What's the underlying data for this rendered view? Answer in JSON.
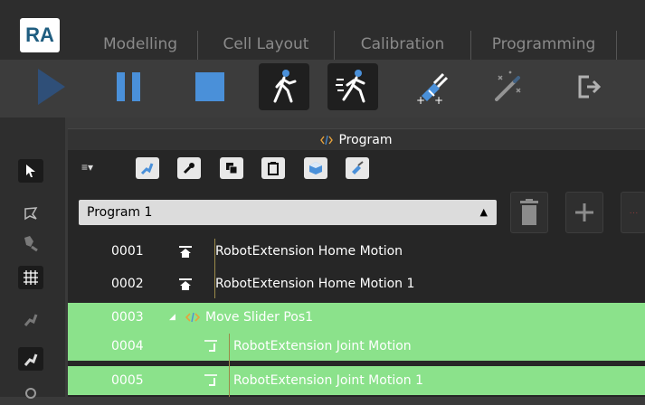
{
  "app": {
    "logo_text": "RA"
  },
  "tabs": [
    {
      "label": "Modelling"
    },
    {
      "label": "Cell Layout"
    },
    {
      "label": "Calibration"
    },
    {
      "label": "Programming"
    }
  ],
  "toolbar": {
    "buttons": [
      {
        "name": "play",
        "icon": "play-icon"
      },
      {
        "name": "pause",
        "icon": "pause-icon"
      },
      {
        "name": "stop",
        "icon": "stop-icon"
      },
      {
        "name": "walk",
        "icon": "walk-icon"
      },
      {
        "name": "run",
        "icon": "run-icon"
      },
      {
        "name": "teach",
        "icon": "teach-icon"
      },
      {
        "name": "magic",
        "icon": "magic-wand-icon"
      },
      {
        "name": "exit",
        "icon": "exit-icon"
      }
    ]
  },
  "panel": {
    "title": "Program",
    "program_select": {
      "value": "Program 1"
    }
  },
  "program_rows": [
    {
      "num": "0001",
      "label": "RobotExtension Home Motion",
      "icon": "home-icon",
      "highlight": false
    },
    {
      "num": "0002",
      "label": "RobotExtension Home Motion 1",
      "icon": "home-icon",
      "highlight": false
    },
    {
      "num": "0003",
      "label": "Move Slider Pos1",
      "icon": "code-icon",
      "highlight": true
    },
    {
      "num": "0004",
      "label": "RobotExtension Joint Motion",
      "icon": "joint-icon",
      "highlight": true
    },
    {
      "num": "0005",
      "label": "RobotExtension Joint Motion 1",
      "icon": "joint-icon",
      "highlight": true
    }
  ],
  "colors": {
    "accent_blue": "#4a90d9",
    "highlight_green": "#8be28b",
    "panel_bg": "#262626"
  }
}
